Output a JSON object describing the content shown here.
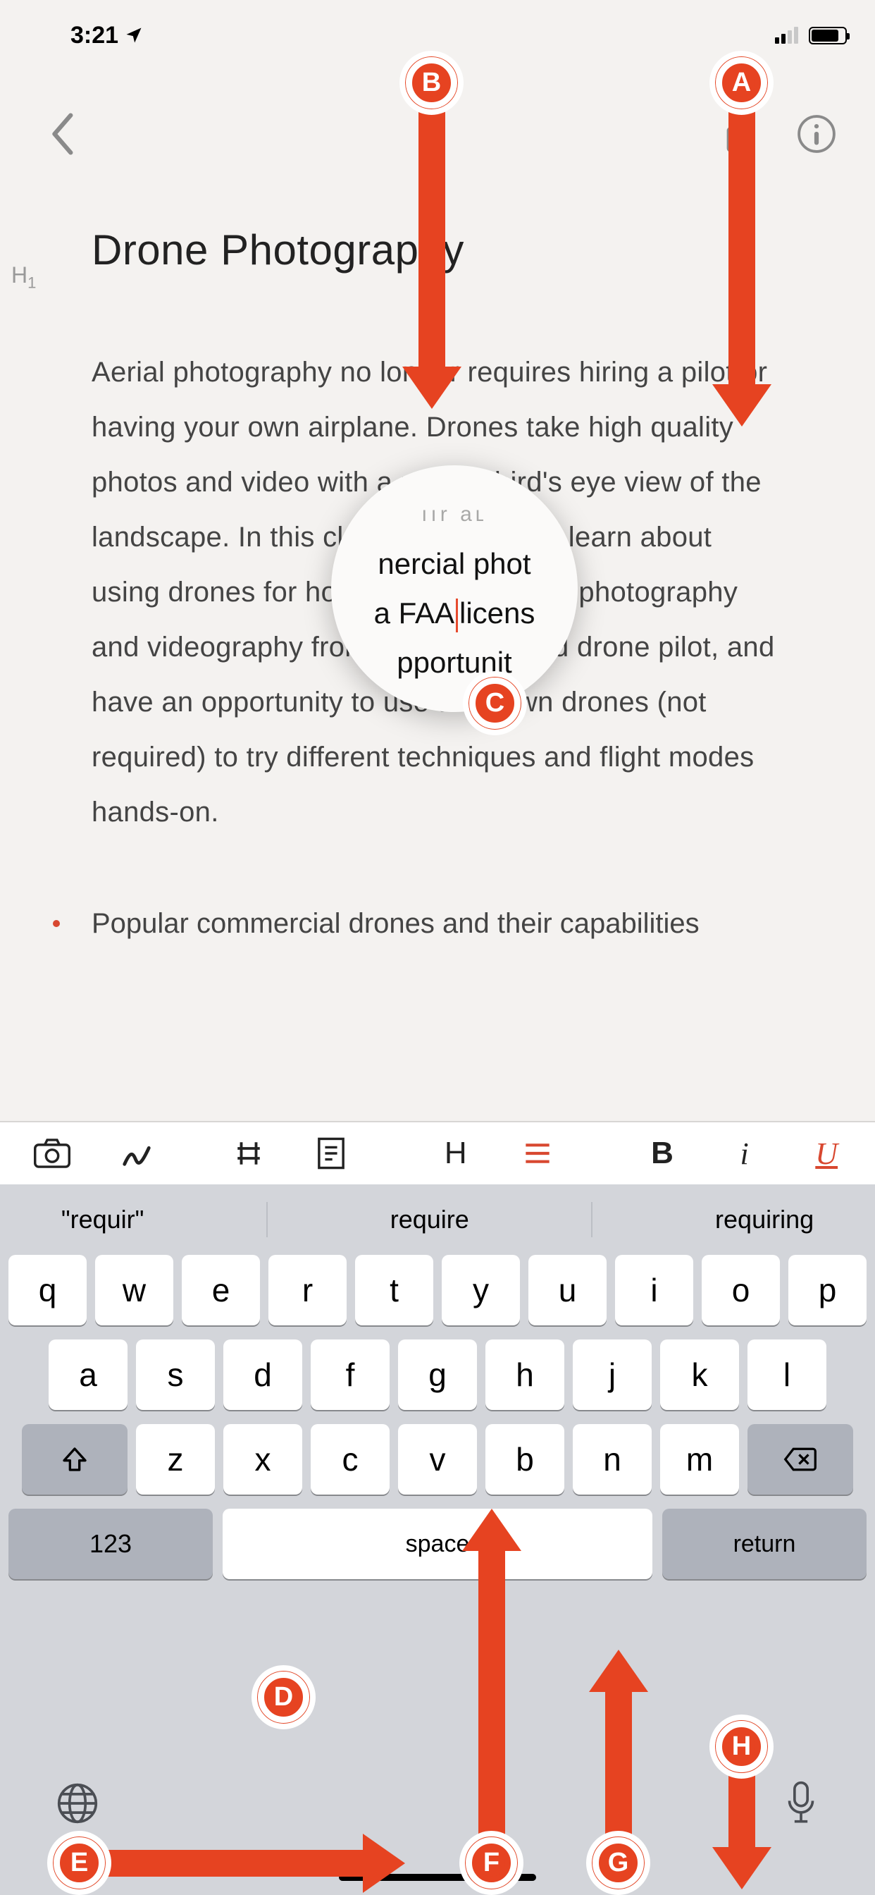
{
  "statusbar": {
    "time": "3:21"
  },
  "document": {
    "h1_marker": "H1",
    "title": "Drone Photography",
    "paragraph": "Aerial photography no longer requires hiring a pilot or having your own airplane. Drones take high quality photos and video with a unique bird's eye view of the landscape. In this class, students will learn about using drones for hobby or commercial photography and videography from a FAA-licensed drone pilot, and have an opportunity to use their own drones (not required) to try different techniques and flight modes hands-on.",
    "bullet1": "Popular commercial drones and their capabilities"
  },
  "loupe": {
    "line1": "nercial phot",
    "line2_left": "a FAA",
    "line2_right": "licens",
    "line3": "pportunit"
  },
  "toolbar": {
    "heading": "H",
    "bold": "B",
    "italic": "i",
    "underline": "U"
  },
  "suggestions": {
    "s1": "\"requir\"",
    "s2": "require",
    "s3": "requiring"
  },
  "keyboard": {
    "row1": [
      "q",
      "w",
      "e",
      "r",
      "t",
      "y",
      "u",
      "i",
      "o",
      "p"
    ],
    "row2": [
      "a",
      "s",
      "d",
      "f",
      "g",
      "h",
      "j",
      "k",
      "l"
    ],
    "row3": [
      "z",
      "x",
      "c",
      "v",
      "b",
      "n",
      "m"
    ],
    "numkey": "123",
    "space": "space",
    "return": "return"
  },
  "annotations": {
    "A": "A",
    "B": "B",
    "C": "C",
    "D": "D",
    "E": "E",
    "F": "F",
    "G": "G",
    "H": "H"
  }
}
